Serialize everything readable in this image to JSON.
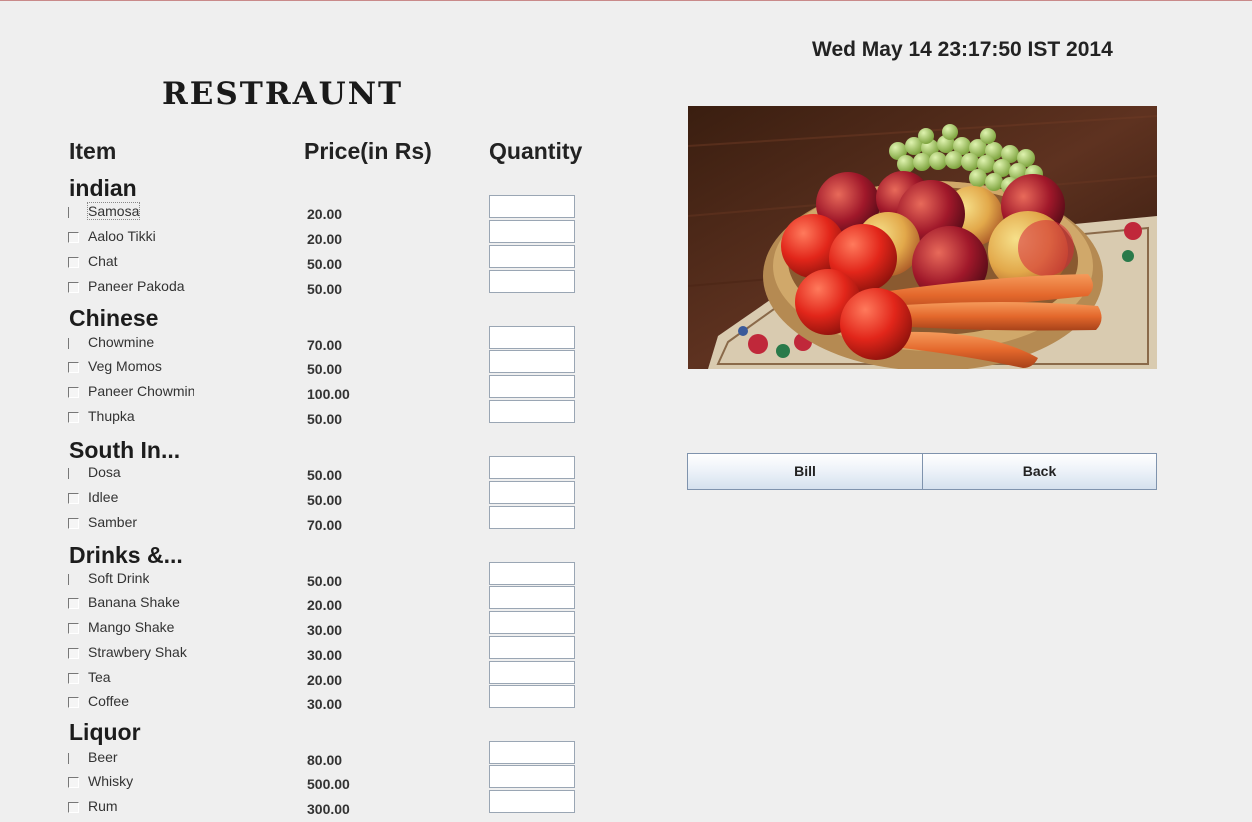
{
  "datetime": "Wed May 14 23:17:50 IST 2014",
  "title": "RESTRAUNT",
  "headers": {
    "item": "Item",
    "price": "Price(in Rs)",
    "quantity": "Quantity"
  },
  "categories": [
    {
      "label": "indian",
      "items": [
        {
          "name": "Samosa",
          "price": "20.00",
          "quantity": ""
        },
        {
          "name": "Aaloo Tikki",
          "price": "20.00",
          "quantity": ""
        },
        {
          "name": "Chat",
          "price": "50.00",
          "quantity": ""
        },
        {
          "name": "Paneer Pakoda",
          "price": "50.00",
          "quantity": ""
        }
      ]
    },
    {
      "label": "Chinese",
      "items": [
        {
          "name": "Chowmine",
          "price": "70.00",
          "quantity": ""
        },
        {
          "name": "Veg Momos",
          "price": "50.00",
          "quantity": ""
        },
        {
          "name": "Paneer Chowmine",
          "price": "100.00",
          "quantity": ""
        },
        {
          "name": "Thupka",
          "price": "50.00",
          "quantity": ""
        }
      ]
    },
    {
      "label": "South In...",
      "items": [
        {
          "name": "Dosa",
          "price": "50.00",
          "quantity": ""
        },
        {
          "name": "Idlee",
          "price": "50.00",
          "quantity": ""
        },
        {
          "name": "Samber",
          "price": "70.00",
          "quantity": ""
        }
      ]
    },
    {
      "label": "Drinks &...",
      "items": [
        {
          "name": "Soft Drink",
          "price": "50.00",
          "quantity": ""
        },
        {
          "name": "Banana Shake",
          "price": "20.00",
          "quantity": ""
        },
        {
          "name": "Mango Shake",
          "price": "30.00",
          "quantity": ""
        },
        {
          "name": "Strawbery Shak",
          "price": "30.00",
          "quantity": ""
        },
        {
          "name": "Tea",
          "price": "20.00",
          "quantity": ""
        },
        {
          "name": "Coffee",
          "price": "30.00",
          "quantity": ""
        }
      ]
    },
    {
      "label": "Liquor",
      "items": [
        {
          "name": "Beer",
          "price": "80.00",
          "quantity": ""
        },
        {
          "name": "Whisky",
          "price": "500.00",
          "quantity": ""
        },
        {
          "name": "Rum",
          "price": "300.00",
          "quantity": ""
        }
      ]
    }
  ],
  "buttons": {
    "bill": "Bill",
    "back": "Back"
  }
}
